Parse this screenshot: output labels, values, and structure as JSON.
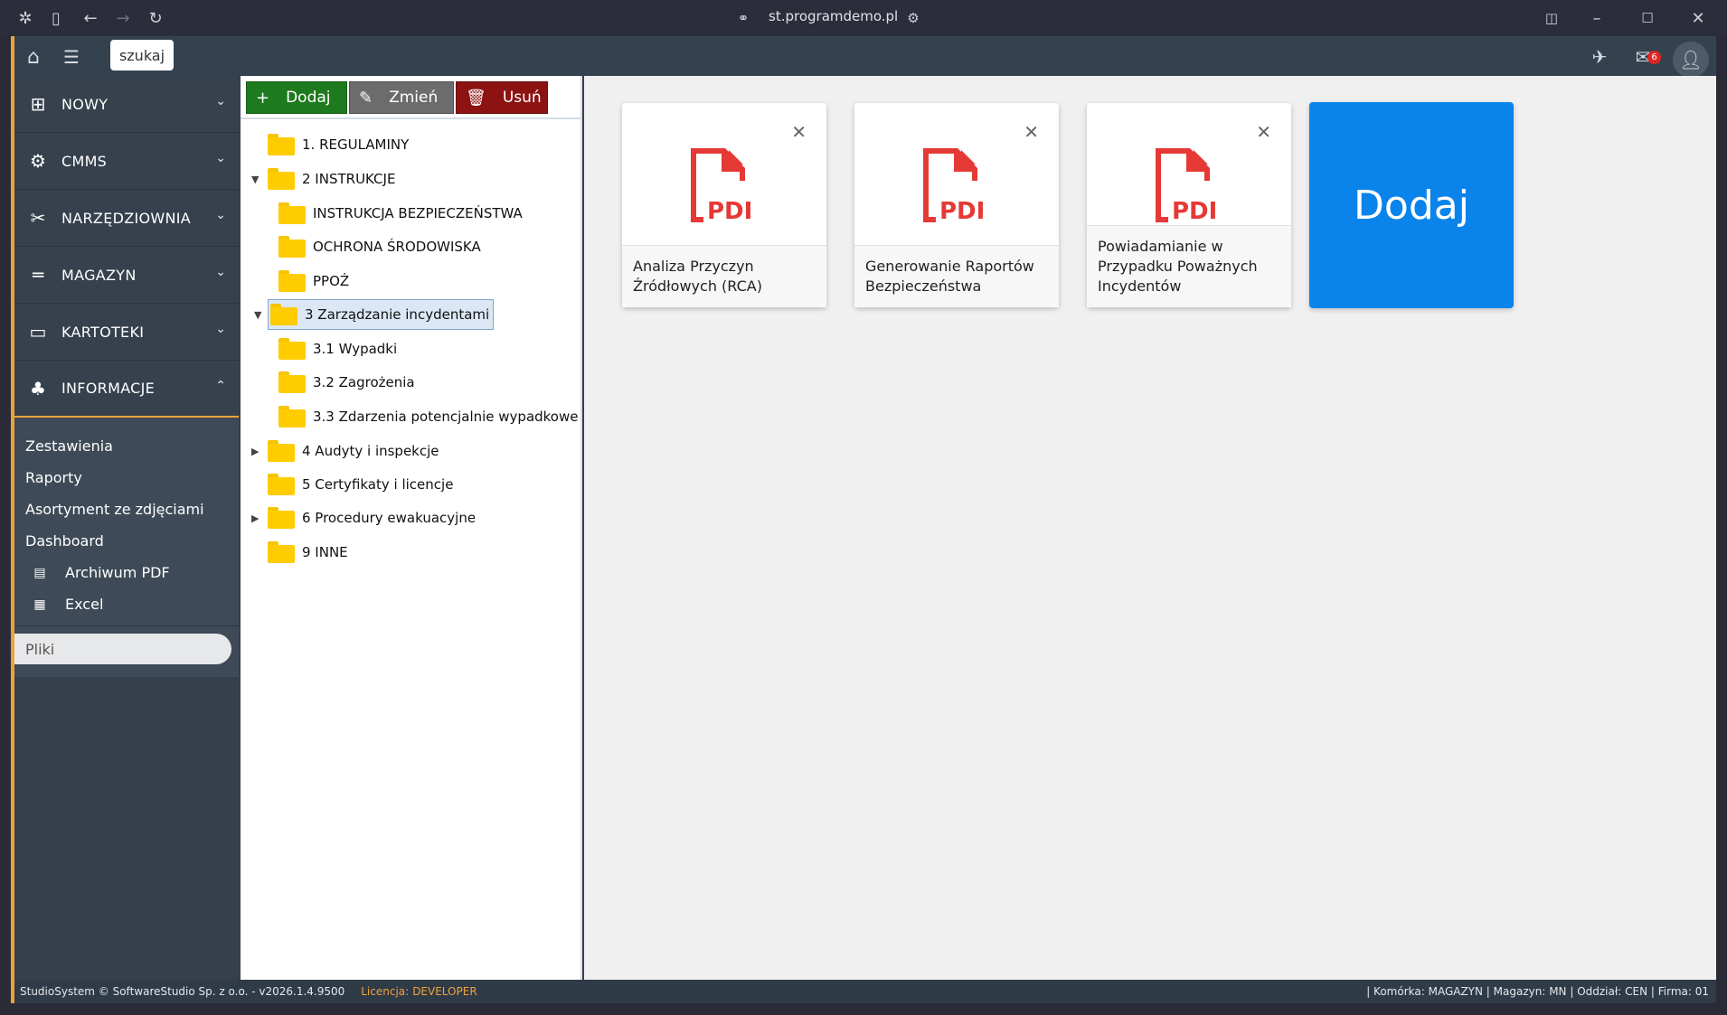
{
  "browser": {
    "url": "st.programdemo.pl"
  },
  "topbar": {
    "search_label": "szukaj",
    "mail_count": "6"
  },
  "sidebar": {
    "sections": [
      {
        "label": "NOWY",
        "icon": "plus-square-icon"
      },
      {
        "label": "CMMS",
        "icon": "gears-icon"
      },
      {
        "label": "NARZĘDZIOWNIA",
        "icon": "tools-icon"
      },
      {
        "label": "MAGAZYN",
        "icon": "pallet-icon"
      },
      {
        "label": "KARTOTEKI",
        "icon": "folder-icon"
      },
      {
        "label": "INFORMACJE",
        "icon": "sitemap-icon"
      }
    ],
    "info_links": [
      "Zestawienia",
      "Raporty",
      "Asortyment ze zdjęciami",
      "Dashboard",
      "Archiwum PDF",
      "Excel"
    ],
    "active_item": "Pliki"
  },
  "tree_toolbar": {
    "add_label": "Dodaj",
    "edit_label": "Zmień",
    "delete_label": "Usuń"
  },
  "tree": [
    "1. REGULAMINY",
    "2 INSTRUKCJE",
    "INSTRUKCJA BEZPIECZEŃSTWA",
    "OCHRONA ŚRODOWISKA",
    "PPOŻ",
    "3 Zarządzanie incydentami",
    "3.1 Wypadki",
    "3.2 Zagrożenia",
    "3.3 Zdarzenia potencjalnie wypadkowe",
    "4 Audyty i inspekcje",
    "5 Certyfikaty i licencje",
    "6 Procedury ewakuacyjne",
    "9 INNE"
  ],
  "files": [
    {
      "name": "Analiza Przyczyn Źródłowych (RCA)",
      "type": "PDF"
    },
    {
      "name": "Generowanie Raportów Bezpieczeństwa",
      "type": "PDF"
    },
    {
      "name": "Powiadamianie w Przypadku Poważnych Incydentów",
      "type": "PDF"
    }
  ],
  "add_card_label": "Dodaj",
  "footer": {
    "copyright": "StudioSystem © SoftwareStudio Sp. z o.o. - v2026.1.4.9500",
    "license_label": "Licencja:",
    "license_value": "DEVELOPER",
    "context": "| Komórka: MAGAZYN | Magazyn: MN | Oddział: CEN | Firma: 01"
  },
  "colors": {
    "accent": "#e8a33c",
    "add_button": "#1e7a1e",
    "edit_button": "#6c6c6c",
    "delete_button": "#8d1212",
    "add_card": "#0a84eb",
    "pdf_red": "#e53935",
    "folder": "#ffcc00"
  }
}
